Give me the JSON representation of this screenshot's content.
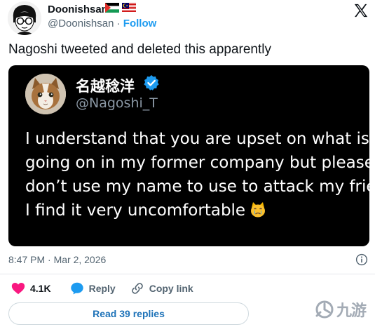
{
  "author": {
    "display_name": "Doonishsan",
    "handle": "@Doonishsan",
    "separator": "·",
    "follow_label": "Follow",
    "flags": [
      "palestine-flag",
      "malaysia-flag"
    ]
  },
  "tweet": {
    "text": "Nagoshi tweeted and deleted this apparently",
    "timestamp": "8:47 PM · Mar 2, 2026"
  },
  "quoted_media": {
    "name": "名越稔洋",
    "handle": "@Nagoshi_T",
    "verified": true,
    "lines": [
      "I understand that you are upset on what is",
      "going on in my former company but please",
      "don’t use my name to use to attack my frie",
      "I find it very uncomfortable"
    ],
    "emoji": "crying-cat-face"
  },
  "actions": {
    "likes_count": "4.1K",
    "reply_label": "Reply",
    "copy_link_label": "Copy link",
    "read_replies_label": "Read 39 replies"
  },
  "colors": {
    "accent": "#1d9bf0",
    "like": "#f91880",
    "text": "#0f1419",
    "secondary": "#536471"
  },
  "watermark": {
    "text": "九游"
  }
}
